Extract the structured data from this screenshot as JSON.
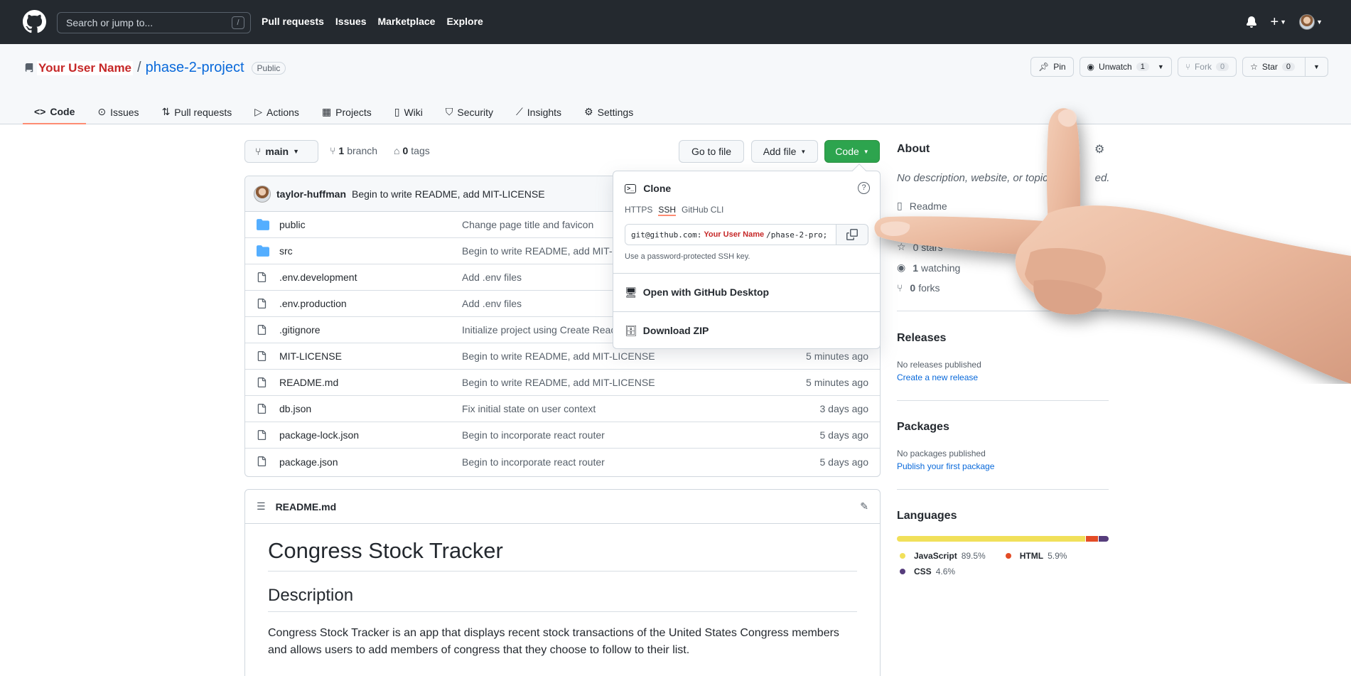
{
  "header": {
    "search_placeholder": "Search or jump to...",
    "search_shortcut": "/",
    "nav": [
      "Pull requests",
      "Issues",
      "Marketplace",
      "Explore"
    ]
  },
  "repo": {
    "owner": "Your User Name",
    "separator": "/",
    "name": "phase-2-project",
    "visibility": "Public",
    "actions": {
      "pin": "Pin",
      "unwatch": "Unwatch",
      "unwatch_count": "1",
      "fork": "Fork",
      "fork_count": "0",
      "star": "Star",
      "star_count": "0"
    },
    "tabs": [
      "Code",
      "Issues",
      "Pull requests",
      "Actions",
      "Projects",
      "Wiki",
      "Security",
      "Insights",
      "Settings"
    ]
  },
  "branchbar": {
    "branch": "main",
    "branches_count": "1",
    "branches_label": "branch",
    "tags_count": "0",
    "tags_label": "tags",
    "go_to_file": "Go to file",
    "add_file": "Add file",
    "code": "Code"
  },
  "commit": {
    "author": "taylor-huffman",
    "message": "Begin to write README, add MIT-LICENSE"
  },
  "files": [
    {
      "name": "public",
      "type": "dir",
      "message": "Change page title and favicon",
      "age": ""
    },
    {
      "name": "src",
      "type": "dir",
      "message": "Begin to write README, add MIT-L",
      "age": ""
    },
    {
      "name": ".env.development",
      "type": "file",
      "message": "Add .env files",
      "age": ""
    },
    {
      "name": ".env.production",
      "type": "file",
      "message": "Add .env files",
      "age": ""
    },
    {
      "name": ".gitignore",
      "type": "file",
      "message": "Initialize project using Create Reac",
      "age": ""
    },
    {
      "name": "MIT-LICENSE",
      "type": "file",
      "message": "Begin to write README, add MIT-LICENSE",
      "age": "5 minutes ago"
    },
    {
      "name": "README.md",
      "type": "file",
      "message": "Begin to write README, add MIT-LICENSE",
      "age": "5 minutes ago"
    },
    {
      "name": "db.json",
      "type": "file",
      "message": "Fix initial state on user context",
      "age": "3 days ago"
    },
    {
      "name": "package-lock.json",
      "type": "file",
      "message": "Begin to incorporate react router",
      "age": "5 days ago"
    },
    {
      "name": "package.json",
      "type": "file",
      "message": "Begin to incorporate react router",
      "age": "5 days ago"
    }
  ],
  "readme": {
    "filename": "README.md",
    "h1": "Congress Stock Tracker",
    "h2": "Description",
    "p": "Congress Stock Tracker is an app that displays recent stock transactions of the United States Congress members and allows users to add members of congress that they choose to follow to their list."
  },
  "clone": {
    "title": "Clone",
    "tabs": [
      "HTTPS",
      "SSH",
      "GitHub CLI"
    ],
    "active_tab": "SSH",
    "url_prefix": "git@github.com:",
    "url_user": "Your User Name",
    "url_suffix": "/phase-2-pro;",
    "hint": "Use a password-protected SSH key.",
    "open_desktop": "Open with GitHub Desktop",
    "download_zip": "Download ZIP"
  },
  "about": {
    "title": "About",
    "description": "No description, website, or topics p",
    "description_tail": "ed.",
    "readme": "Readme",
    "stars": "0 stars",
    "watching_count": "1",
    "watching_label": "watching",
    "forks_count": "0",
    "forks_label": "forks"
  },
  "releases": {
    "title": "Releases",
    "none": "No releases published",
    "create": "Create a new release"
  },
  "packages": {
    "title": "Packages",
    "none": "No packages published",
    "publish": "Publish your first package"
  },
  "languages": {
    "title": "Languages",
    "items": [
      {
        "name": "JavaScript",
        "pct": "89.5%",
        "value": 89.5,
        "color": "#f1e05a"
      },
      {
        "name": "HTML",
        "pct": "5.9%",
        "value": 5.9,
        "color": "#e34c26"
      },
      {
        "name": "CSS",
        "pct": "4.6%",
        "value": 4.6,
        "color": "#563d7c"
      }
    ]
  }
}
